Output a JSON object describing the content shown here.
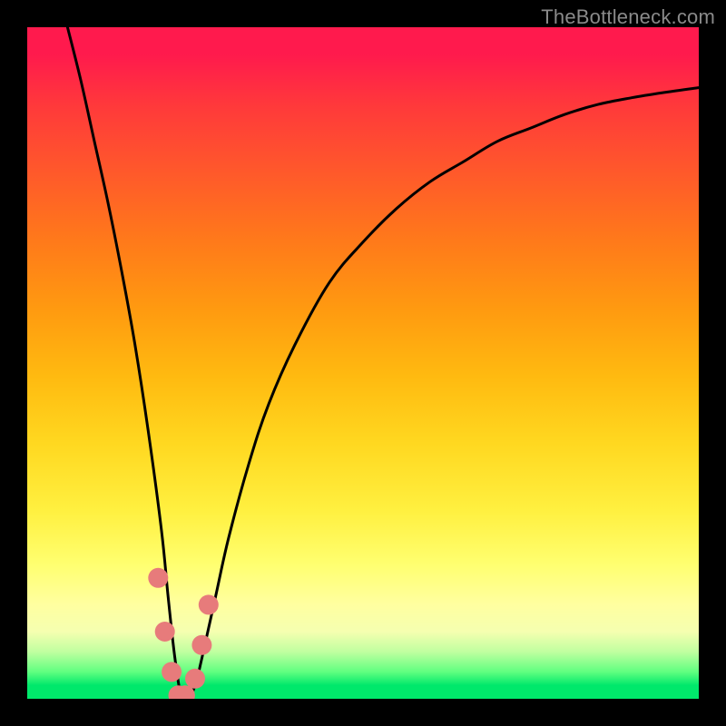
{
  "watermark": {
    "text": "TheBottleneck.com"
  },
  "colors": {
    "curve_stroke": "#000000",
    "marker_fill": "#e77b7b",
    "gradient_top": "#ff1a4d",
    "gradient_bottom": "#00e86b",
    "frame": "#000000"
  },
  "chart_data": {
    "type": "line",
    "title": "",
    "xlabel": "",
    "ylabel": "",
    "xlim": [
      0,
      100
    ],
    "ylim": [
      0,
      100
    ],
    "grid": false,
    "legend": false,
    "series": [
      {
        "name": "bottleneck-curve",
        "x": [
          6,
          8,
          10,
          12,
          14,
          16,
          18,
          20,
          21,
          22,
          23,
          24,
          25,
          26,
          28,
          30,
          33,
          36,
          40,
          45,
          50,
          55,
          60,
          65,
          70,
          75,
          80,
          85,
          90,
          95,
          100
        ],
        "values": [
          100,
          92,
          83,
          74,
          64,
          53,
          40,
          25,
          15,
          6,
          0,
          0,
          2,
          6,
          15,
          24,
          35,
          44,
          53,
          62,
          68,
          73,
          77,
          80,
          83,
          85,
          87,
          88.5,
          89.5,
          90.3,
          91
        ]
      }
    ],
    "markers": [
      {
        "x": 19.5,
        "y": 18
      },
      {
        "x": 20.5,
        "y": 10
      },
      {
        "x": 21.5,
        "y": 4
      },
      {
        "x": 22.5,
        "y": 0.5
      },
      {
        "x": 23.5,
        "y": 0.5
      },
      {
        "x": 25.0,
        "y": 3
      },
      {
        "x": 26.0,
        "y": 8
      },
      {
        "x": 27.0,
        "y": 14
      }
    ]
  }
}
